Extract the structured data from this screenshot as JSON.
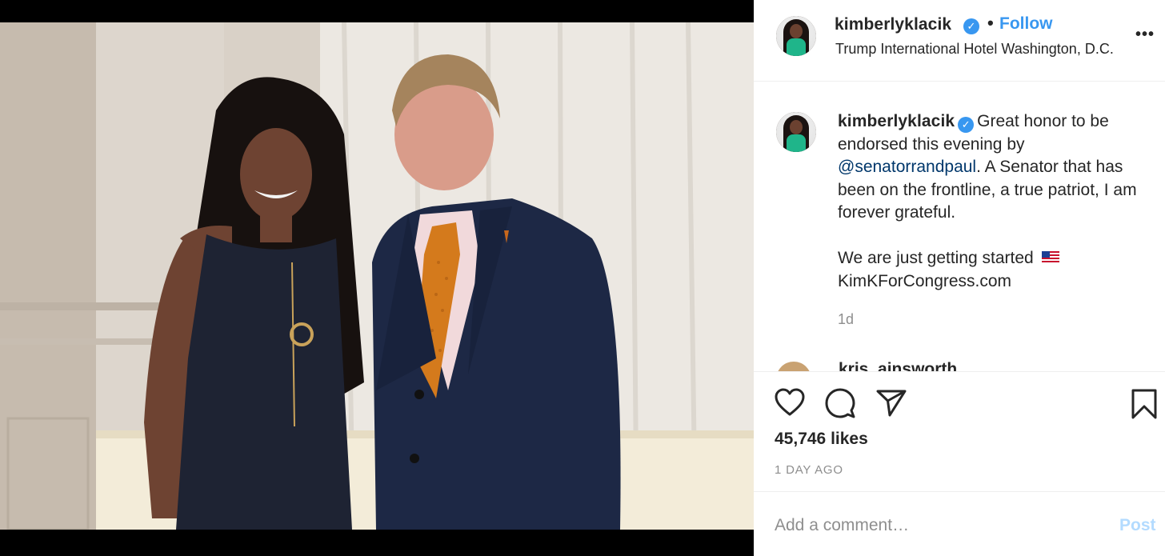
{
  "post": {
    "image_alt": "Photo of two people posing indoors",
    "author": {
      "username": "kimberlyklacik",
      "verified": true,
      "follow_label": "Follow",
      "location": "Trump International Hotel Washington, D.C."
    },
    "more_icon": "more-horizontal-icon",
    "caption": {
      "username": "kimberlyklacik",
      "text_1": "Great honor to be endorsed this evening by",
      "mention": "@senatorrandpaul",
      "text_2": ". A Senator that has been on the frontline, a true patriot, I am forever grateful.",
      "text_3": "We are just getting started",
      "flag_icon": "us-flag-icon",
      "link_text": "KimKForCongress.com",
      "time": "1d"
    },
    "next_comment_username": "kris_ainsworth",
    "actions": {
      "like_icon": "heart-icon",
      "comment_icon": "comment-icon",
      "share_icon": "send-icon",
      "save_icon": "bookmark-icon"
    },
    "likes": "45,746 likes",
    "posted_ago": "1 DAY AGO",
    "comment_placeholder": "Add a comment…",
    "post_label": "Post"
  },
  "colors": {
    "accent": "#3897f0",
    "mention": "#00376b",
    "muted": "#8e8e8e",
    "post_disabled": "#b3dbff"
  }
}
